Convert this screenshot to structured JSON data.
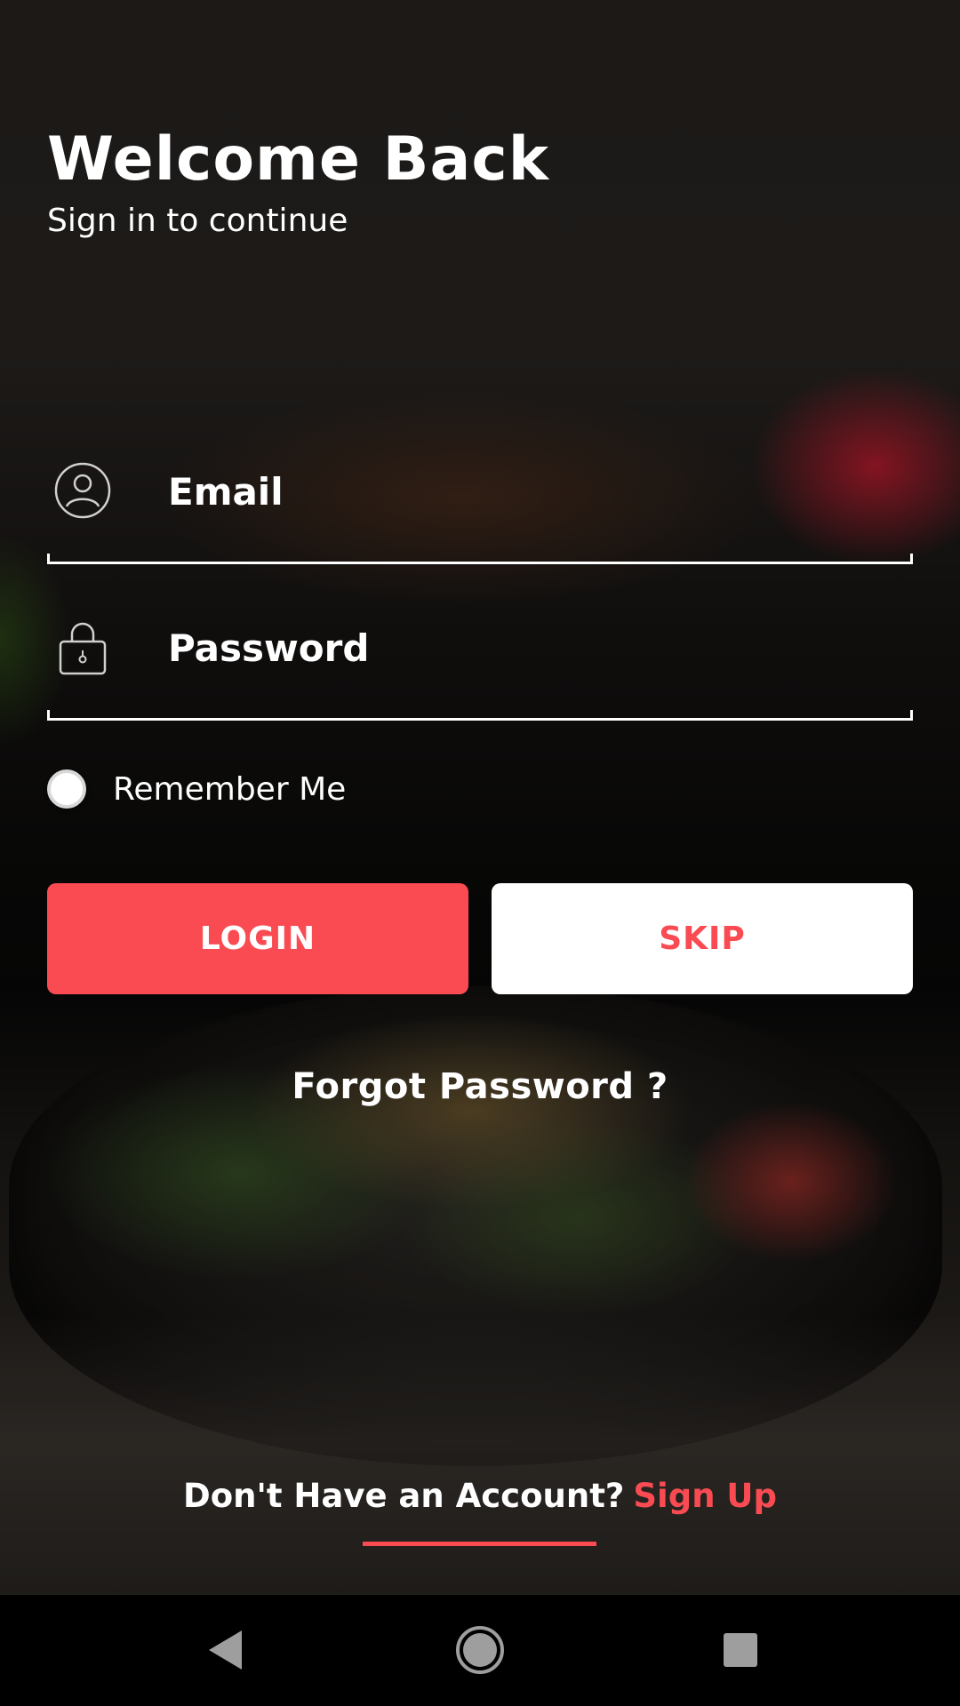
{
  "header": {
    "title": "Welcome Back",
    "subtitle": "Sign in to continue"
  },
  "form": {
    "email_placeholder": "Email",
    "email_value": "",
    "email_icon": "user-circle-icon",
    "password_placeholder": "Password",
    "password_value": "",
    "password_icon": "lock-icon",
    "remember_label": "Remember Me",
    "remember_checked": false
  },
  "actions": {
    "login_label": "LOGIN",
    "skip_label": "SKIP",
    "forgot_label": "Forgot Password ?"
  },
  "footer": {
    "prompt": "Don't Have an Account?",
    "signup_label": "Sign Up"
  },
  "system_nav": {
    "back_icon": "back-triangle-icon",
    "home_icon": "home-circle-icon",
    "recents_icon": "recents-square-icon"
  },
  "colors": {
    "accent": "#fa4b53",
    "text": "#ffffff",
    "navbar": "#000000"
  }
}
